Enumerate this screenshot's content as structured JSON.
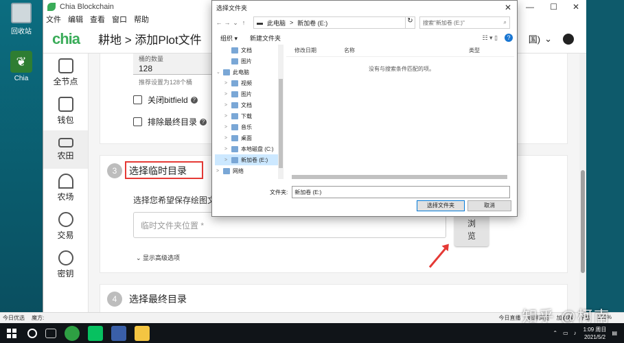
{
  "desktop": {
    "recycle_label": "回收站",
    "chia_label": "Chia"
  },
  "chia_window": {
    "title": "Chia Blockchain",
    "menu": [
      "文件",
      "编辑",
      "查看",
      "窗口",
      "帮助"
    ],
    "logo": "chia",
    "breadcrumb": "耕地 > 添加Plot文件",
    "header_right": "国)",
    "controls": {
      "min": "—",
      "max": "☐",
      "close": "✕"
    }
  },
  "sidebar": {
    "items": [
      {
        "label": "全节点",
        "icon": "home-icon"
      },
      {
        "label": "钱包",
        "icon": "wallet-icon"
      },
      {
        "label": "农田",
        "icon": "hdd-icon",
        "active": true
      },
      {
        "label": "农场",
        "icon": "plant-icon"
      },
      {
        "label": "交易",
        "icon": "trade-icon"
      },
      {
        "label": "密钥",
        "icon": "key-icon"
      }
    ]
  },
  "card1": {
    "bucket_label": "桶的数量",
    "bucket_value": "128",
    "bucket_hint": "推荐设置为128个桶",
    "check1": "关闭bitfield",
    "check2": "排除最终目录"
  },
  "card2": {
    "step": "3",
    "title": "选择临时目录",
    "desc": "选择您希望保存绘图文件",
    "input_placeholder": "临时文件夹位置 *",
    "browse": "浏\n览",
    "advanced": "显示高级选项"
  },
  "card3": {
    "step": "4",
    "title": "选择最终目录"
  },
  "dialog": {
    "title": "选择文件夹",
    "addr_parts": [
      "此电脑",
      ">",
      "新加卷 (E:)"
    ],
    "search_placeholder": "搜索\"新加卷 (E:)\"",
    "organize": "组织 ▾",
    "new_folder": "新建文件夹",
    "help": "?",
    "tree": [
      {
        "label": "文档",
        "indent": 1
      },
      {
        "label": "图片",
        "indent": 1
      },
      {
        "label": "此电脑",
        "indent": 0,
        "chev": "⌄"
      },
      {
        "label": "视频",
        "indent": 1,
        "chev": ">"
      },
      {
        "label": "图片",
        "indent": 1,
        "chev": ">"
      },
      {
        "label": "文档",
        "indent": 1,
        "chev": ">"
      },
      {
        "label": "下载",
        "indent": 1,
        "chev": ">"
      },
      {
        "label": "音乐",
        "indent": 1,
        "chev": ">"
      },
      {
        "label": "桌面",
        "indent": 1,
        "chev": ">"
      },
      {
        "label": "本地磁盘 (C:)",
        "indent": 1,
        "chev": ">"
      },
      {
        "label": "新加卷 (E:)",
        "indent": 1,
        "chev": ">",
        "selected": true
      },
      {
        "label": "网络",
        "indent": 0,
        "chev": ">"
      }
    ],
    "columns": [
      "修改日期",
      "名称",
      "类型"
    ],
    "empty": "没有与搜索条件匹配的项。",
    "folder_label": "文件夹:",
    "folder_value": "新加卷 (E:)",
    "ok": "选择文件夹",
    "cancel": "取消"
  },
  "strip": {
    "left": [
      "今日优选",
      "魔方:"
    ],
    "right": [
      "今日直播",
      "跨屏浏览",
      "加速器",
      "下载",
      "100%"
    ]
  },
  "watermark": "知乎 @柯南",
  "taskbar": {
    "time": "1:09 周日",
    "date": "2021/5/2"
  }
}
